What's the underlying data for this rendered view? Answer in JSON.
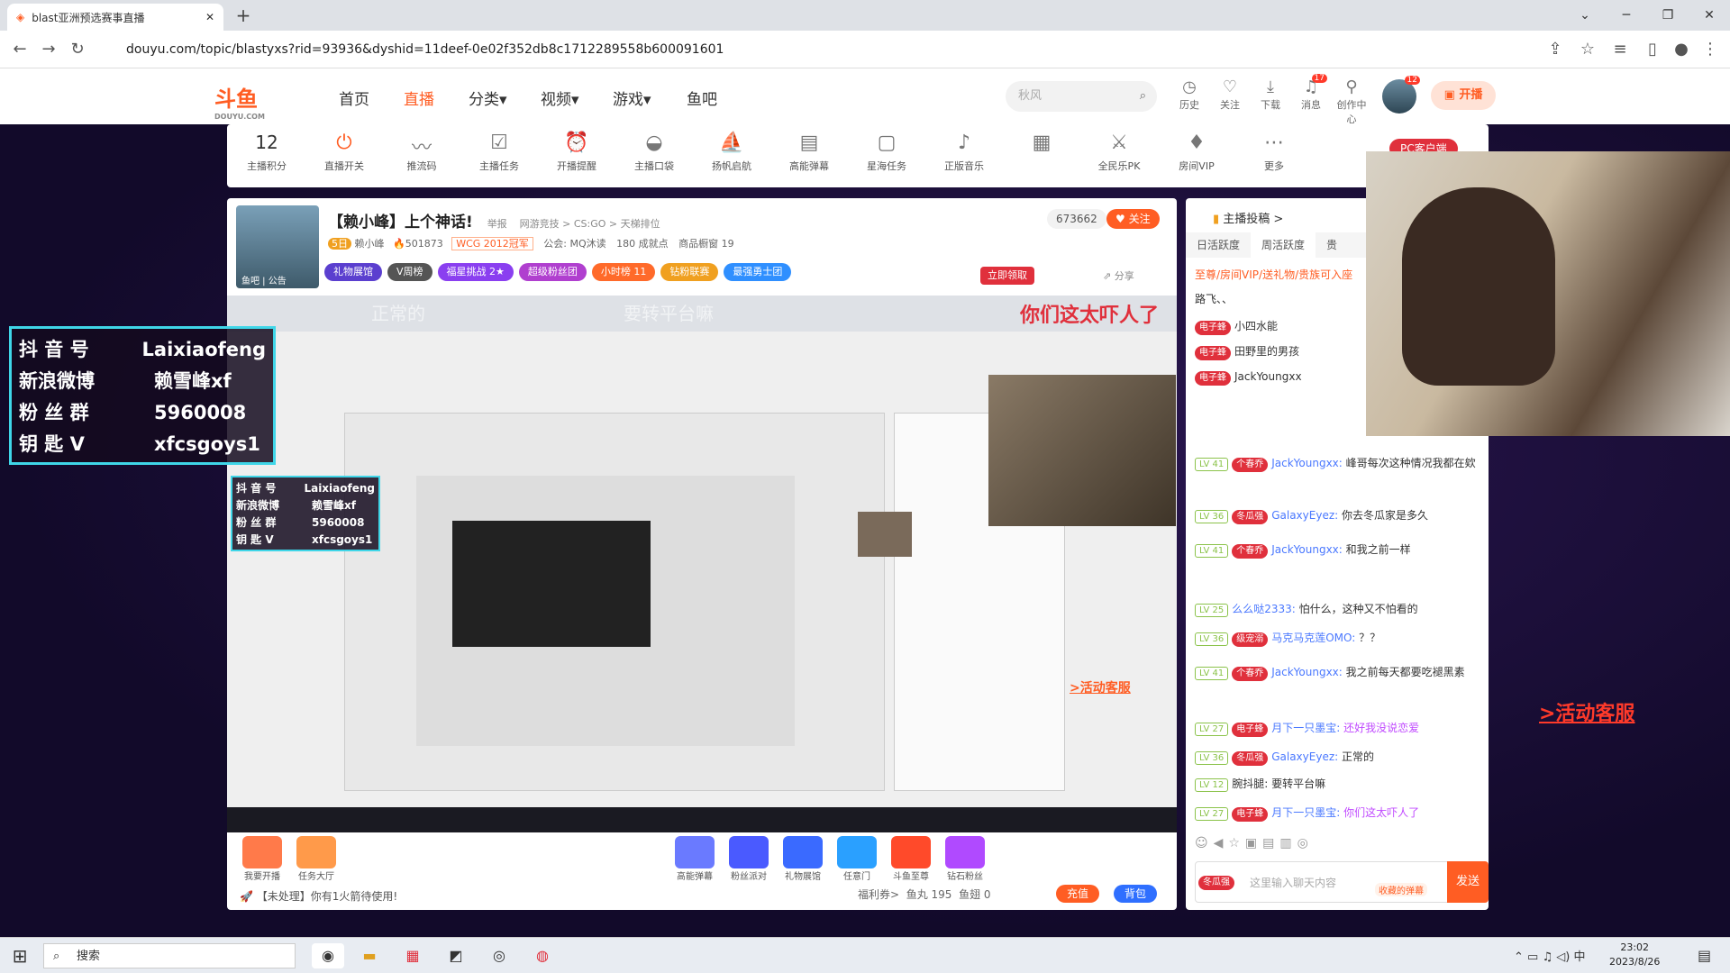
{
  "browser": {
    "tab_title": "blast亚洲预选赛事直播",
    "url": "douyu.com/topic/blastyxs?rid=93936&dyshid=11deef-0e02f352db8c1712289558b600091601"
  },
  "header": {
    "logo": "斗鱼",
    "logo_sub": "DOUYU.COM",
    "nav": [
      "首页",
      "直播",
      "分类▾",
      "视频▾",
      "游戏▾",
      "鱼吧"
    ],
    "search_placeholder": "秋风",
    "icons": [
      {
        "icon": "history-icon",
        "label": "历史"
      },
      {
        "icon": "heart-icon",
        "label": "关注"
      },
      {
        "icon": "download-icon",
        "label": "下载"
      },
      {
        "icon": "bell-icon",
        "label": "消息",
        "badge": "17"
      },
      {
        "icon": "bulb-icon",
        "label": "创作中心"
      }
    ],
    "avatar_badge": "12",
    "start_live": "开播"
  },
  "toolbar": [
    {
      "icon": "score",
      "label": "主播积分",
      "value": "12"
    },
    {
      "icon": "toggle-icon",
      "label": "直播开关",
      "badge": "1"
    },
    {
      "icon": "wave-icon",
      "label": "推流码"
    },
    {
      "icon": "clipboard-icon",
      "label": "主播任务"
    },
    {
      "icon": "alarm-icon",
      "label": "开播提醒"
    },
    {
      "icon": "pocket-icon",
      "label": "主播口袋"
    },
    {
      "icon": "sail-icon",
      "label": "扬帆启航"
    },
    {
      "icon": "barrage-icon",
      "label": "高能弹幕"
    },
    {
      "icon": "ad-icon",
      "label": "星海任务"
    },
    {
      "icon": "music-icon",
      "label": "正版音乐"
    },
    {
      "icon": "gift-icon",
      "label": ""
    },
    {
      "icon": "pk-icon",
      "label": "全民乐PK"
    },
    {
      "icon": "vip-icon",
      "label": "房间VIP"
    },
    {
      "icon": "more-icon",
      "label": "更多"
    }
  ],
  "room": {
    "title": "【赖小峰】上个神话!",
    "report": "举报",
    "category": "网游竞技 > CS:GO > 天梯排位",
    "level_badge": "5日",
    "anchor": "赖小峰",
    "hot": "501873",
    "honor": "WCG 2012冠军",
    "guild": "公会: MQ沐读",
    "achievements": "180 成就点",
    "shop": "商品橱窗 19",
    "avatar_caption": "鱼吧 | 公告",
    "fans_count": "673662",
    "follow": "关注",
    "share": "分享",
    "claim": "立即领取",
    "badges": [
      {
        "label": "礼物展馆",
        "color": "#5b3fcf"
      },
      {
        "label": "V周榜",
        "color": "#555555"
      },
      {
        "label": "福星挑战 2★",
        "color": "#8a3ff0"
      },
      {
        "label": "超级粉丝团",
        "color": "#b03fcf"
      },
      {
        "label": "小时榜 11",
        "color": "#ff6a2a"
      },
      {
        "label": "钻粉联赛",
        "color": "#f0a020"
      },
      {
        "label": "最强勇士团",
        "color": "#2f8fff"
      }
    ]
  },
  "video": {
    "overlay1": "正常的",
    "overlay2": "要转平台嘛",
    "overlay3": "你们这太吓人了",
    "activity": ">活动客服"
  },
  "gifts": [
    {
      "label": "我要开播",
      "color": "#ff7a4a"
    },
    {
      "label": "任务大厅",
      "color": "#ff9a4a"
    },
    {
      "label": "高能弹幕",
      "color": "#6a7aff"
    },
    {
      "label": "粉丝派对",
      "color": "#4a5aff"
    },
    {
      "label": "礼物展馆",
      "color": "#3a6aff"
    },
    {
      "label": "任意门",
      "color": "#2aa0ff"
    },
    {
      "label": "斗鱼至尊",
      "color": "#ff4a2a"
    },
    {
      "label": "钻石粉丝",
      "color": "#b04aff"
    }
  ],
  "bottom": {
    "notice": "【未处理】你有1火箭待使用!",
    "welfare": "福利券>",
    "fish_pill": "鱼丸 195",
    "fish_ball": "鱼翅 0",
    "recharge": "充值",
    "pack": "背包"
  },
  "chat": {
    "contribution": "主播投稿 >",
    "tabs": [
      "日活跃度",
      "周活跃度",
      "贵"
    ],
    "vip_line": "至尊/房间VIP/送礼物/贵族可入座",
    "seated": [
      {
        "name": "路飞、、",
        "badge": ""
      },
      {
        "name": "小四水能",
        "badge": "电子蜂"
      },
      {
        "name": "田野里的男孩",
        "badge": "电子蜂"
      },
      {
        "name": "JackYoungxx",
        "badge": "电子蜂"
      }
    ],
    "messages": [
      {
        "lv": "LV 41",
        "fan": "个春乔",
        "nick": "JackYoungxx:",
        "text": "峰哥每次这种情况我都在欸"
      },
      {
        "lv": "LV 36",
        "fan": "冬瓜强",
        "nick": "GalaxyEyez:",
        "text": "你去冬瓜家是多久"
      },
      {
        "lv": "LV 41",
        "fan": "个春乔",
        "nick": "JackYoungxx:",
        "text": "和我之前一样"
      },
      {
        "lv": "LV 25",
        "fan": "",
        "nick": "么么哒2333:",
        "text": "怕什么，这种又不怕看的"
      },
      {
        "lv": "LV 36",
        "fan": "级宠溺",
        "nick": "马克马克莲OMO:",
        "text": "？？"
      },
      {
        "lv": "LV 41",
        "fan": "个春乔",
        "nick": "JackYoungxx:",
        "text": "我之前每天都要吃褪黑素"
      },
      {
        "lv": "LV 27",
        "fan": "电子蜂",
        "nick": "月下一只墨宝:",
        "text": "还好我没说恋爱"
      },
      {
        "lv": "LV 36",
        "fan": "冬瓜强",
        "nick": "GalaxyEyez:",
        "text": "正常的"
      },
      {
        "lv": "LV 12",
        "fan": "",
        "nick": "腕抖腿:",
        "text": "要转平台嘛"
      },
      {
        "lv": "LV 27",
        "fan": "电子蜂",
        "nick": "月下一只墨宝:",
        "text": "你们这太吓人了"
      }
    ],
    "input_placeholder": "这里输入聊天内容",
    "input_badge": "冬瓜强",
    "barrage_btn": "收藏的弹幕",
    "send": "发送"
  },
  "webcam": {
    "badge": "PC客户端"
  },
  "social": [
    {
      "k": "抖 音 号",
      "v": "Laixiaofeng"
    },
    {
      "k": "新浪微博",
      "v": "赖雪峰xf"
    },
    {
      "k": "粉 丝 群",
      "v": "5960008"
    },
    {
      "k": "钥 匙 V",
      "v": "xfcsgoys1"
    }
  ],
  "taskbar": {
    "search": "搜索",
    "time": "23:02",
    "date": "2023/8/26",
    "ime": "中"
  }
}
